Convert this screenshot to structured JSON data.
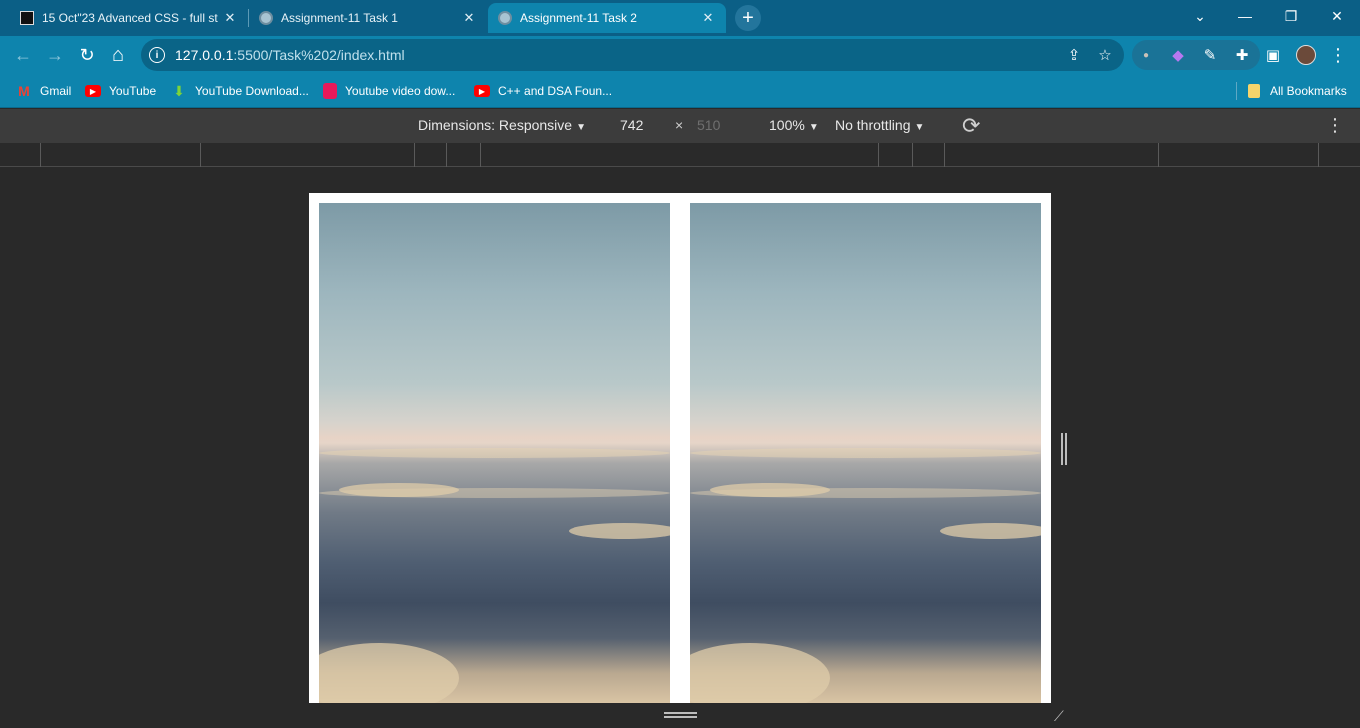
{
  "tabs": [
    {
      "title": "15 Oct\"23 Advanced CSS - full st",
      "close": "✕"
    },
    {
      "title": "Assignment-11 Task 1",
      "close": "✕"
    },
    {
      "title": "Assignment-11 Task 2",
      "close": "✕"
    }
  ],
  "new_tab": "+",
  "window_controls": {
    "menu": "⌄",
    "minimize": "—",
    "restore": "❐",
    "close": "✕"
  },
  "nav": {
    "back": "←",
    "forward": "→",
    "reload": "↻",
    "home": "⌂"
  },
  "address": {
    "host": "127.0.0.1",
    "path": ":5500/Task%202/index.html",
    "info": "i"
  },
  "omnibox_icons": {
    "share": "⇪",
    "star": "☆"
  },
  "extensions": {
    "ext1": "●",
    "ext2": "◆",
    "dropper": "✎",
    "puzzle": "✚",
    "sidepanel": "▣",
    "menu": "⋮"
  },
  "bookmarks": [
    {
      "label": "Gmail",
      "icon": "gmail"
    },
    {
      "label": "YouTube",
      "icon": "youtube"
    },
    {
      "label": "YouTube Download...",
      "icon": "download"
    },
    {
      "label": "Youtube video dow...",
      "icon": "square"
    },
    {
      "label": "C++ and DSA Foun...",
      "icon": "youtube"
    }
  ],
  "all_bookmarks": "All Bookmarks",
  "devtools": {
    "dimensions_label": "Dimensions: Responsive",
    "width": "742",
    "times": "×",
    "height": "510",
    "zoom": "100%",
    "throttling": "No throttling",
    "rotate_icon": "⟳",
    "more_icon": "⋮",
    "caret": "▼"
  },
  "resize_corner": "⟋"
}
